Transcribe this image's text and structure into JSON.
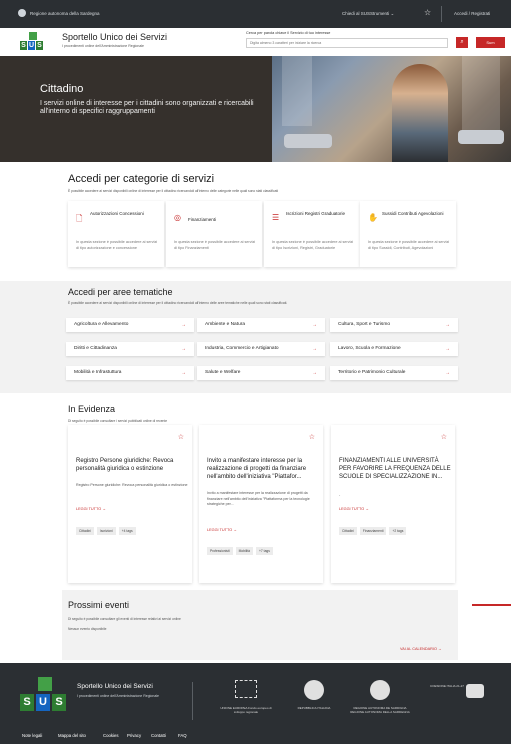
{
  "topbar": {
    "region": "Regione autonoma della Sardegna",
    "ask": "Chiedi al SUS",
    "tools": "Strumenti",
    "login": "Accedi / Registrati"
  },
  "header": {
    "logo_letters": [
      "S",
      "U",
      "S"
    ],
    "title": "Sportello Unico dei Servizi",
    "subtitle": "I procedimenti online dell'Amministrazione Regionale",
    "search_label": "Cerca per parola chiave il Servizio di tuo interesse",
    "search_placeholder": "Digita almeno 3 caratteri per iniziare la ricerca",
    "search_icon": "search-icon",
    "sum_label": "Sum"
  },
  "hero": {
    "title": "Cittadino",
    "description": "I servizi online di interesse per i cittadini sono organizzati e ricercabili all'interno di specifici raggruppamenti"
  },
  "categories": {
    "title": "Accedi per categorie di servizi",
    "subtitle": "È possibile accedere ai servizi disponibili online di interesse per il cittadino ricercandoli all'interno delle categorie nelle quali sono stati classificati",
    "items": [
      {
        "icon": "document-icon",
        "label": "Autorizzazioni Concessioni",
        "desc": "In questa sezione è possibile accedere ai servizi di tipo autorizzazione e concessione"
      },
      {
        "icon": "coins-icon",
        "label": "Finanziamenti",
        "desc": "In questa sezione è possibile accedere ai servizi di tipo Finanziamenti"
      },
      {
        "icon": "list-icon",
        "label": "Iscrizioni Registri Graduatorie",
        "desc": "In questa sezione è possibile accedere ai servizi di tipo Iscrizioni, Registri, Graduatorie"
      },
      {
        "icon": "hand-coins-icon",
        "label": "Sussidi Contributi Agevolazioni",
        "desc": "In questa sezione è possibile accedere ai servizi di tipo Sussidi, Contributi, Agevolazioni"
      }
    ]
  },
  "areas": {
    "title": "Accedi per aree tematiche",
    "subtitle": "È possibile accedere ai servizi disponibili online di interesse per il cittadino ricercandoli all'interno delle aree tematiche nelle quali sono stati classificati.",
    "items": [
      "Agricoltura e Allevamento",
      "Ambiente e Natura",
      "Cultura, Sport e Turismo",
      "Diritti e Cittadinanza",
      "Industria, Commercio e Artigianato",
      "Lavoro, Scuola e Formazione",
      "Mobilità e Infrastuttura",
      "Salute e Welfare",
      "Territorio e Patrimonio Culturale"
    ]
  },
  "evidence": {
    "title": "In Evidenza",
    "subtitle": "Di seguito è possibile consultare i servizi pubblicati online di recente",
    "more_label": "LEGGI TUTTO",
    "cards": [
      {
        "title": "Registro Persone giuridiche: Revoca personalità giuridica o estinzione",
        "desc": "Registro Persone giuridiche: Revoca personalità giuridica o estinzione",
        "tags": [
          "Cittadini",
          "Iscrizioni",
          "+4 tags"
        ]
      },
      {
        "title": "Invito a manifestare interesse per la realizzazione di progetti da finanziare nell'ambito dell'iniziativa \"Piattafor...",
        "desc": "Invito a manifestare interesse per la realizzazione di progetti da finanziare nell'ambito dell'iniziativa \"Piattaforma per la tecnologie strategiche per...",
        "tags": [
          "Professionisti",
          "Mobilità",
          "+7 tags"
        ]
      },
      {
        "title": "FINANZIAMENTI ALLE UNIVERSITÀ PER FAVORIRE LA FREQUENZA DELLE SCUOLE DI SPECIALIZZAZIONE IN...",
        "desc": "-",
        "tags": [
          "Cittadini",
          "Finanziamenti",
          "+2 tags"
        ]
      }
    ],
    "all_link": "VAI A TUTTI I SERVIZI IN EVIDENZA"
  },
  "events": {
    "title": "Prossimi eventi",
    "subtitle": "Di seguito è possibile consultare gli eventi di interesse relativi ai servizi online",
    "empty": "Nessun evento disponibile",
    "calendar_link": "VAI AL CALENDARIO"
  },
  "footer": {
    "logo_letters": [
      "S",
      "U",
      "S"
    ],
    "title": "Sportello Unico dei Servizi",
    "subtitle": "I procedimenti online dell'Amministrazione Regionale",
    "partners": [
      {
        "icon": "eu-flag-icon",
        "caption": "UNIONE EUROPEA Fondo europeo di sviluppo regionale"
      },
      {
        "icon": "republic-emblem-icon",
        "caption": "REPUBBLICA ITALIANA"
      },
      {
        "icon": "sardinia-emblem-icon",
        "caption": "REGIONE AUTONOMA DE SARDIGNA REGIONE AUTONOMA DELLA SARDEGNA"
      },
      {
        "icon": "coesione-italia-icon",
        "caption": "COESIONE ITALIA 21-27"
      }
    ],
    "links": [
      "Note legali",
      "Mappa del sito",
      "Cookies",
      "Privacy",
      "Contatti",
      "FAQ"
    ]
  },
  "colors": {
    "accent": "#c62828",
    "dark": "#2b2f33",
    "hero": "#35302c"
  }
}
